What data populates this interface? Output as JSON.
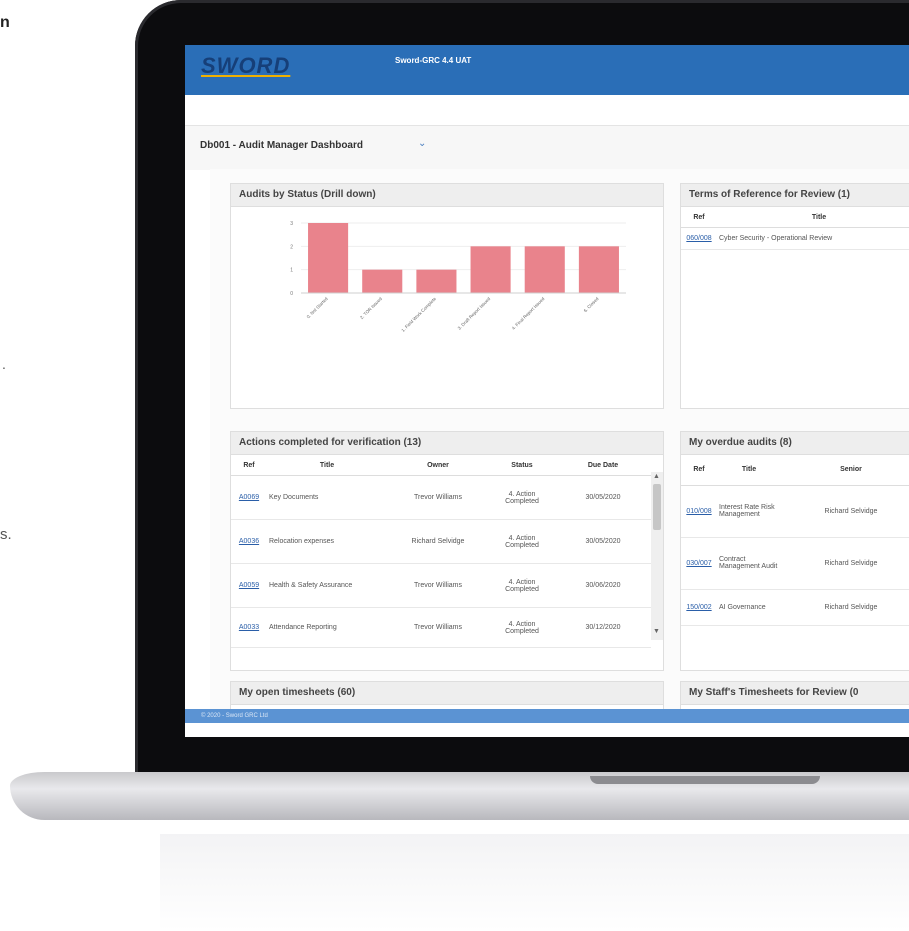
{
  "edge": {
    "heading_fragment": "n",
    "period_fragment": ".",
    "text_fragment": "s."
  },
  "app": {
    "logo": "SWORD",
    "title": "Sword-GRC 4.4 UAT",
    "footer": "© 2020 - Sword GRC Ltd"
  },
  "dashboard": {
    "title": "Db001 - Audit Manager Dashboard",
    "caret": "⌄"
  },
  "colors": {
    "header": "#2a6eb7",
    "bar": "#e9838c",
    "footer": "#5b93d3",
    "link": "#2a5ea8"
  },
  "panels": {
    "audits_status": "Audits by Status (Drill down)",
    "terms_ref": "Terms of Reference for Review (1)",
    "actions": "Actions completed for verification (13)",
    "overdue": "My overdue audits (8)",
    "open_ts": "My open timesheets (60)",
    "staff_ts": "My Staff's Timesheets for Review (0"
  },
  "chart_data": {
    "type": "bar",
    "categories": [
      "0. Not Started",
      "2. TOR Issued",
      "1. Field Work Complete",
      "3. Draft Report Issued",
      "4. Final Report Issued",
      "6. Closed"
    ],
    "values": [
      3,
      1,
      1,
      2,
      2,
      2
    ],
    "ylim": [
      0,
      3
    ],
    "yticks": [
      "0",
      "1",
      "2",
      "3"
    ],
    "title": "",
    "xlabel": "",
    "ylabel": ""
  },
  "terms": {
    "headers": [
      "Ref",
      "Title"
    ],
    "rows": [
      {
        "ref": "060/008",
        "title": "Cyber Security - Operational Review"
      }
    ]
  },
  "actions": {
    "headers": [
      "Ref",
      "Title",
      "Owner",
      "Status",
      "Due Date"
    ],
    "rows": [
      {
        "ref": "A0069",
        "title": "Key Documents",
        "owner": "Trevor Williams",
        "status": "4. Action Completed",
        "due": "30/05/2020"
      },
      {
        "ref": "A0036",
        "title": "Relocation expenses",
        "owner": "Richard Selvidge",
        "status": "4. Action Completed",
        "due": "30/05/2020"
      },
      {
        "ref": "A0059",
        "title": "Health & Safety Assurance",
        "owner": "Trevor Williams",
        "status": "4. Action Completed",
        "due": "30/06/2020"
      },
      {
        "ref": "A0033",
        "title": "Attendance Reporting",
        "owner": "Trevor Williams",
        "status": "4. Action Completed",
        "due": "30/12/2020"
      }
    ]
  },
  "overdue": {
    "headers": [
      "Ref",
      "Title",
      "Senior"
    ],
    "rows": [
      {
        "ref": "010/008",
        "title": "Interest Rate Risk Management",
        "senior": "Richard Selvidge"
      },
      {
        "ref": "030/007",
        "title": "Contract Management Audit",
        "senior": "Richard Selvidge"
      },
      {
        "ref": "150/002",
        "title": "AI Governance",
        "senior": "Richard Selvidge"
      }
    ]
  }
}
